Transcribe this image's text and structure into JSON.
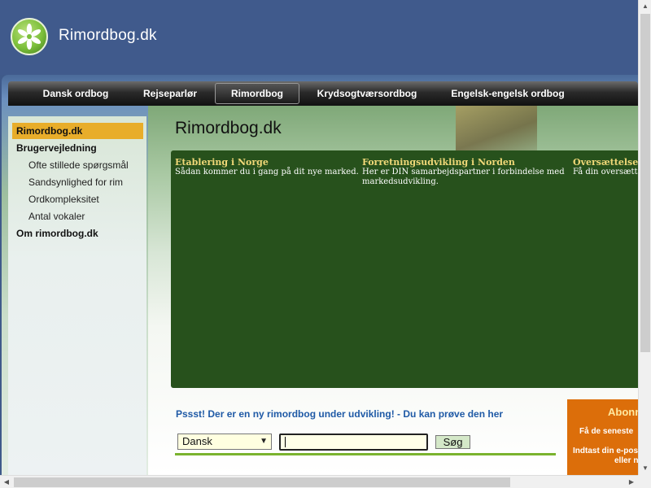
{
  "header": {
    "site_title": "Rimordbog.dk",
    "logo_icon": "flower-logo-icon"
  },
  "nav": {
    "items": [
      {
        "label": "Dansk ordbog",
        "active": false
      },
      {
        "label": "Rejseparlør",
        "active": false
      },
      {
        "label": "Rimordbog",
        "active": true
      },
      {
        "label": "Krydsogtværsordbog",
        "active": false
      },
      {
        "label": "Engelsk-engelsk ordbog",
        "active": false
      }
    ]
  },
  "sidebar": {
    "items": [
      {
        "label": "Rimordbog.dk",
        "level": "top",
        "active": true
      },
      {
        "label": "Brugervejledning",
        "level": "top",
        "active": false
      },
      {
        "label": "Ofte stillede spørgsmål",
        "level": "sub",
        "active": false
      },
      {
        "label": "Sandsynlighed for rim",
        "level": "sub",
        "active": false
      },
      {
        "label": "Ordkompleksitet",
        "level": "sub",
        "active": false
      },
      {
        "label": "Antal vokaler",
        "level": "sub",
        "active": false
      },
      {
        "label": "Om rimordbog.dk",
        "level": "top",
        "active": false
      }
    ]
  },
  "main": {
    "page_title": "Rimordbog.dk",
    "ads": [
      {
        "title": "Etablering i Norge",
        "text": "Sådan kommer du i gang på dit nye marked."
      },
      {
        "title": "Forretningsudvikling i Norden",
        "text_line1": "Her er DIN samarbejdspartner i forbindelse med",
        "text_line2": "markedsudvikling."
      },
      {
        "title": "Oversættelse",
        "text": "Få din oversætt"
      }
    ],
    "notice": "Pssst! Der er en ny rimordbog under udvikling! - Du kan prøve den her"
  },
  "search": {
    "language_selected": "Dansk",
    "query_value": "",
    "button_label": "Søg"
  },
  "subscribe": {
    "title": "Abonn",
    "line1": "Få de seneste",
    "line2": "Indtast din e-pos",
    "line3": "eller n"
  },
  "colors": {
    "header_bg": "#405a8c",
    "nav_bg": "#1b1b1b",
    "sidebar_active": "#e8ad2a",
    "ad_panel": "#27511c",
    "ad_title": "#f0d878",
    "link_blue": "#1f5aa6",
    "subscribe_bg": "#dc6e0a",
    "accent_green": "#7ab32e"
  }
}
